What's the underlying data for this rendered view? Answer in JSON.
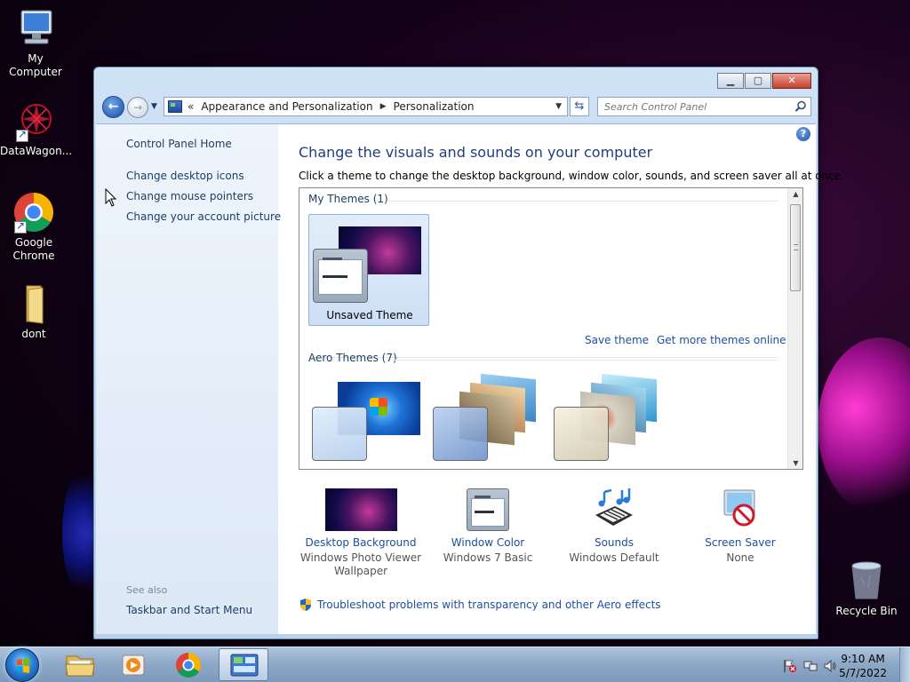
{
  "desktop": {
    "icons": [
      {
        "label": "My Computer"
      },
      {
        "label": "DataWagon..."
      },
      {
        "label": "Google Chrome"
      },
      {
        "label": "dont"
      },
      {
        "label": "Recycle Bin"
      }
    ]
  },
  "window": {
    "breadcrumb": {
      "overflow": "«",
      "items": [
        "Appearance and Personalization",
        "Personalization"
      ]
    },
    "search_placeholder": "Search Control Panel",
    "left_pane": {
      "home": "Control Panel Home",
      "links": [
        "Change desktop icons",
        "Change mouse pointers",
        "Change your account picture"
      ],
      "see_also_label": "See also",
      "see_also": [
        "Taskbar and Start Menu"
      ]
    },
    "main": {
      "title": "Change the visuals and sounds on your computer",
      "subtitle": "Click a theme to change the desktop background, window color, sounds, and screen saver all at once.",
      "my_themes": {
        "header": "My Themes (1)",
        "themes": [
          {
            "name": "Unsaved Theme",
            "selected": true
          }
        ],
        "save_link": "Save theme",
        "more_link": "Get more themes online"
      },
      "aero_themes": {
        "header": "Aero Themes (7)"
      },
      "bottom": [
        {
          "title": "Desktop Background",
          "value": "Windows Photo Viewer Wallpaper"
        },
        {
          "title": "Window Color",
          "value": "Windows 7 Basic"
        },
        {
          "title": "Sounds",
          "value": "Windows Default"
        },
        {
          "title": "Screen Saver",
          "value": "None"
        }
      ],
      "troubleshoot": "Troubleshoot problems with transparency and other Aero effects"
    }
  },
  "taskbar": {
    "clock_time": "9:10 AM",
    "clock_date": "5/7/2022"
  },
  "colors": {
    "link": "#1e4fa0",
    "title": "#1e3e80",
    "selection": "#cddff6"
  }
}
